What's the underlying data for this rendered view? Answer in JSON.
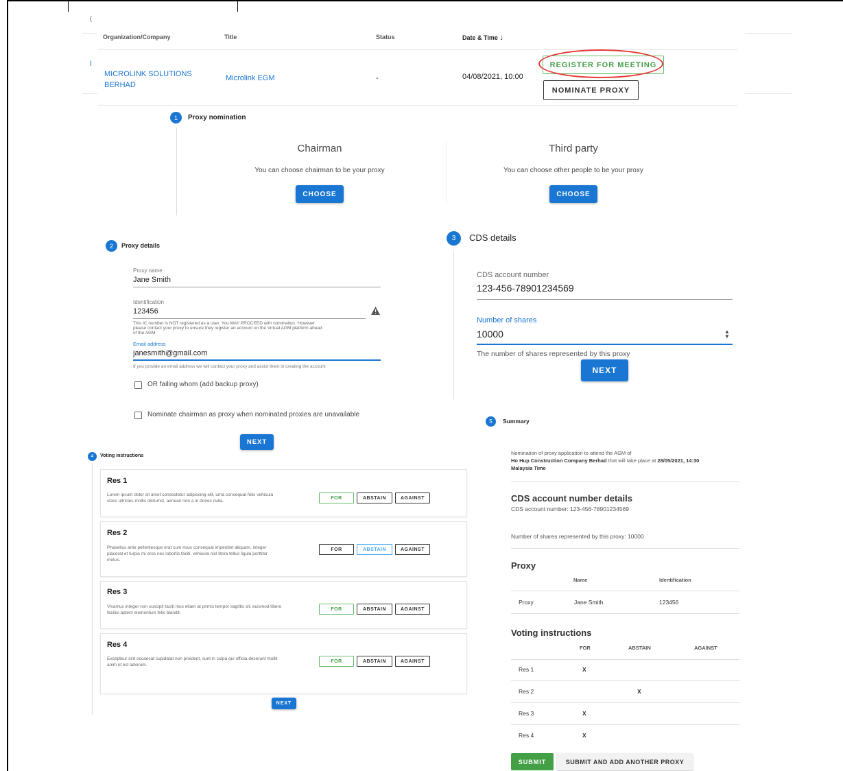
{
  "table": {
    "headers": {
      "org": "Organization/Company",
      "title": "Title",
      "status": "Status",
      "datetime": "Date & Time"
    },
    "row": {
      "org_line1": "MICROLINK SOLUTIONS",
      "org_line2": "BERHAD",
      "title": "Microlink EGM",
      "status": "-",
      "datetime": "04/08/2021, 10:00"
    },
    "register_label": "REGISTER FOR MEETING",
    "nominate_label": "NOMINATE PROXY",
    "left_fragment_1": "(",
    "left_fragment_2": "I"
  },
  "step1": {
    "number": "1",
    "label": "Proxy nomination",
    "chairman": {
      "title": "Chairman",
      "desc": "You can choose chairman to be your proxy",
      "button": "CHOOSE"
    },
    "third": {
      "title": "Third party",
      "desc": "You can choose other people to be your proxy",
      "button": "CHOOSE"
    }
  },
  "step2": {
    "number": "2",
    "label": "Proxy details",
    "proxy_name_label": "Proxy name",
    "proxy_name_value": "Jane Smith",
    "ident_label": "Identification",
    "ident_value": "123456",
    "warning_line1": "This IC number is NOT registered as a user. You MAY PROCEED with nomination. However",
    "warning_line2": "please contact your proxy to ensure they register an account on the Virtual AGM platform ahead",
    "warning_line3": "of the AGM",
    "email_label": "Email address",
    "email_value": "janesmith@gmail.com",
    "email_help": "If you provide an email address we will contact your proxy and assist them in creating the account",
    "backup_label": "OR failing whom (add backup proxy)",
    "chairman_label": "Nominate chairman as proxy when nominated proxies are unavailable",
    "next": "NEXT"
  },
  "step3": {
    "number": "3",
    "label": "CDS details",
    "cds_label": "CDS account number",
    "cds_value": "123-456-78901234569",
    "shares_label": "Number of shares",
    "shares_value": "10000",
    "shares_help": "The number of shares represented by this proxy",
    "next": "NEXT"
  },
  "step4": {
    "number": "4",
    "label": "Voting instructions",
    "resolutions": [
      {
        "title": "Res 1",
        "desc": "Lorem ipsum dolor sit amet consectetur adipiscing elit, urna consequat felis vehicula class ultricies mollis dictumst, aenean non a in donec nulla.",
        "selected": "FOR"
      },
      {
        "title": "Res 2",
        "desc": "Phasellus ante pellentesque erat cum risus consequat imperdiet aliquam, integer placerat et turpis mi eros nec lobortis taciti, vehicula nisl litora tellus ligula porttitor metus.",
        "selected": "ABSTAIN"
      },
      {
        "title": "Res 3",
        "desc": "Vivamus integer non suscipit taciti mus etiam at primis tempor sagittis sit, euismod libero facilisi aptent elementum felis blandit.",
        "selected": "FOR"
      },
      {
        "title": "Res 4",
        "desc": "Excepteur sint occaecat cupidatat non proident, sunt in culpa qui officia deserunt mollit anim id est laborum.",
        "selected": "FOR"
      }
    ],
    "for_label": "FOR",
    "abstain_label": "ABSTAIN",
    "against_label": "AGAINST",
    "next": "NEXT"
  },
  "step5": {
    "number": "5",
    "label": "Summary",
    "intro_line1": "Nomination of proxy application to attend the AGM of",
    "company": "Ho Hup Construction Company Berhad",
    "intro_mid": "that will take place at",
    "date": "28/05/2021, 14:30",
    "tz": "Malaysia Time",
    "cds_heading": "CDS account number details",
    "cds_line": "CDS account number: 123-456-78901234569",
    "shares_line": "Number of shares represented by this proxy: 10000",
    "proxy_heading": "Proxy",
    "proxy_cols": {
      "name": "Name",
      "ident": "Identification"
    },
    "proxy_row": {
      "role": "Proxy",
      "name": "Jane Smith",
      "ident": "123456"
    },
    "voting_heading": "Voting instructions",
    "vote_cols": {
      "for": "FOR",
      "abstain": "ABSTAIN",
      "against": "AGAINST"
    },
    "votes": [
      {
        "res": "Res 1",
        "for": "X",
        "abstain": "",
        "against": ""
      },
      {
        "res": "Res 2",
        "for": "",
        "abstain": "X",
        "against": ""
      },
      {
        "res": "Res 3",
        "for": "X",
        "abstain": "",
        "against": ""
      },
      {
        "res": "Res 4",
        "for": "X",
        "abstain": "",
        "against": ""
      }
    ],
    "submit": "SUBMIT",
    "submit_add": "SUBMIT AND ADD ANOTHER PROXY"
  },
  "colors": {
    "primary": "#1976d2",
    "success": "#43a047",
    "annotation": "#e53935"
  }
}
